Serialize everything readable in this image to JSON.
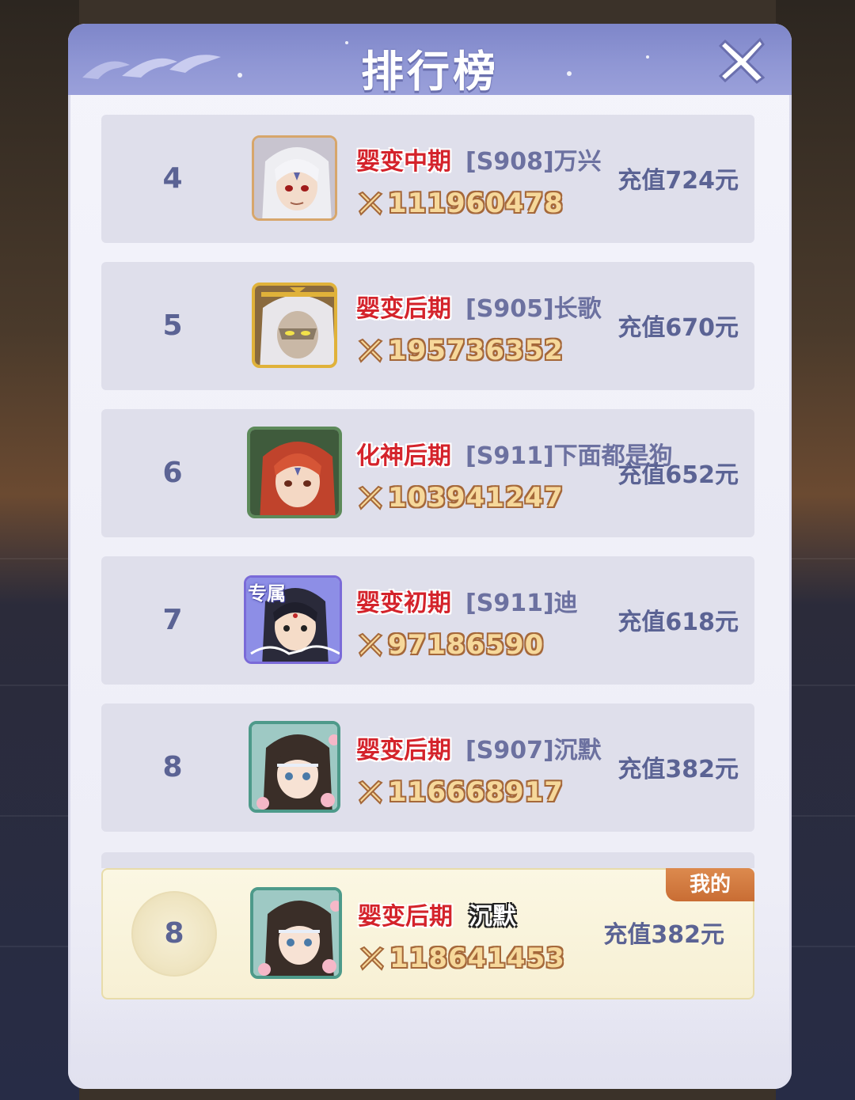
{
  "dialog": {
    "title": "排行榜",
    "close_icon": "close-x-icon"
  },
  "colors": {
    "header": "#8f96d4",
    "realm_red": "#d4232b",
    "power_gold": "#f6d89a",
    "text_blue": "#5b6394",
    "my_badge": "#c96d34"
  },
  "rankings": [
    {
      "rank": "4",
      "realm": "婴变中期",
      "server_name": "[S908]万兴",
      "power": "111960478",
      "recharge": "充值724元",
      "avatar_icon": "white-hair-hero-avatar"
    },
    {
      "rank": "5",
      "realm": "婴变后期",
      "server_name": "[S905]长歌",
      "power": "195736352",
      "recharge": "充值670元",
      "avatar_icon": "masked-elder-avatar"
    },
    {
      "rank": "6",
      "realm": "化神后期",
      "server_name": "[S911]下面都是狗",
      "power": "103941247",
      "recharge": "充值652元",
      "avatar_icon": "red-hair-hero-avatar"
    },
    {
      "rank": "7",
      "realm": "婴变初期",
      "server_name": "[S911]迪",
      "power": "97186590",
      "recharge": "充值618元",
      "avatar_icon": "exclusive-music-avatar",
      "avatar_tag": "专属"
    },
    {
      "rank": "8",
      "realm": "婴变后期",
      "server_name": "[S907]沉默",
      "power": "116668917",
      "recharge": "充值382元",
      "avatar_icon": "blossom-hero-avatar"
    }
  ],
  "my_rank": {
    "badge": "我的",
    "rank": "8",
    "realm": "婴变后期",
    "name": "沉默",
    "power": "118641453",
    "recharge": "充值382元",
    "avatar_icon": "blossom-hero-avatar"
  }
}
